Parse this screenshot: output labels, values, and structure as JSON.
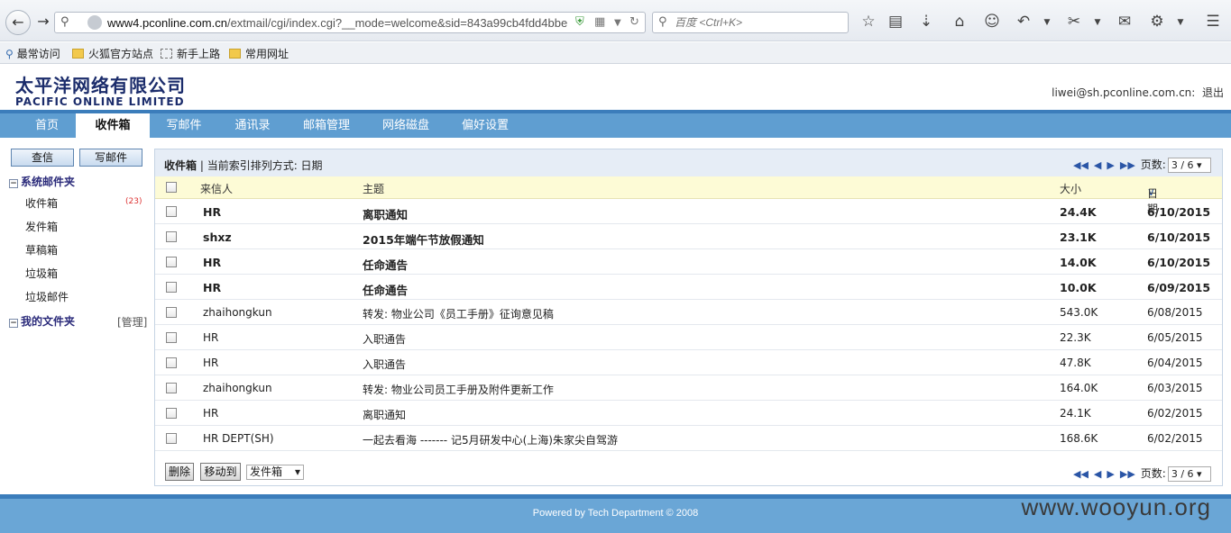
{
  "browser": {
    "url_host": "www4.pconline.com.cn",
    "url_path": "/extmail/cgi/index.cgi?__mode=welcome&sid=843a99cb4fdd4bbe",
    "search_placeholder": "百度 <Ctrl+K>",
    "bookmarks": [
      "最常访问",
      "火狐官方站点",
      "新手上路",
      "常用网址"
    ]
  },
  "brand": {
    "cn": "太平洋网络有限公司",
    "en": "PACIFIC ONLINE LIMITED"
  },
  "user": {
    "email": "liwei@sh.pconline.com.cn:",
    "logout": "退出"
  },
  "nav": {
    "tabs": [
      "首页",
      "收件箱",
      "写邮件",
      "通讯录",
      "邮箱管理",
      "网络磁盘",
      "偏好设置"
    ],
    "active_index": 1
  },
  "sidebar": {
    "check_mail": "查信",
    "compose": "写邮件",
    "system_folders_title": "系统邮件夹",
    "folders": [
      "收件箱",
      "发件箱",
      "草稿箱",
      "垃圾箱",
      "垃圾邮件"
    ],
    "inbox_unread": "(23)",
    "my_folders_title": "我的文件夹",
    "manage": "[管理]"
  },
  "list": {
    "title": "收件箱",
    "subtitle": " | 当前索引排列方式: 日期",
    "pages_label": "页数:",
    "page_select": "3 / 6",
    "columns": {
      "from": "来信人",
      "subject": "主题",
      "size": "大小",
      "date": "日期"
    },
    "rows": [
      {
        "from": "HR",
        "subject": "离职通知",
        "size": "24.4K",
        "date": "6/10/2015",
        "unread": true
      },
      {
        "from": "shxz",
        "subject": "2015年端午节放假通知",
        "size": "23.1K",
        "date": "6/10/2015",
        "unread": true
      },
      {
        "from": "HR",
        "subject": "任命通告",
        "size": "14.0K",
        "date": "6/10/2015",
        "unread": true
      },
      {
        "from": "HR",
        "subject": "任命通告",
        "size": "10.0K",
        "date": "6/09/2015",
        "unread": true
      },
      {
        "from": "zhaihongkun",
        "subject": "转发: 物业公司《员工手册》征询意见稿",
        "size": "543.0K",
        "date": "6/08/2015",
        "unread": false
      },
      {
        "from": "HR",
        "subject": "入职通告",
        "size": "22.3K",
        "date": "6/05/2015",
        "unread": false
      },
      {
        "from": "HR",
        "subject": "入职通告",
        "size": "47.8K",
        "date": "6/04/2015",
        "unread": false
      },
      {
        "from": "zhaihongkun",
        "subject": "转发: 物业公司员工手册及附件更新工作",
        "size": "164.0K",
        "date": "6/03/2015",
        "unread": false
      },
      {
        "from": "HR",
        "subject": "离职通知",
        "size": "24.1K",
        "date": "6/02/2015",
        "unread": false
      },
      {
        "from": "HR DEPT(SH)",
        "subject": "一起去看海 ------- 记5月研发中心(上海)朱家尖自驾游",
        "size": "168.6K",
        "date": "6/02/2015",
        "unread": false
      }
    ],
    "delete_btn": "删除",
    "move_btn": "移动到",
    "move_target": "发件箱"
  },
  "footer": {
    "copyright": "Powered by Tech Department © 2008"
  },
  "watermark": "www.wooyun.org",
  "colors": {
    "nav_bar": "#5f9ed1",
    "nav_border": "#3b7dbb",
    "header_yellow": "#fdfbd6",
    "list_head": "#e6edf6"
  }
}
